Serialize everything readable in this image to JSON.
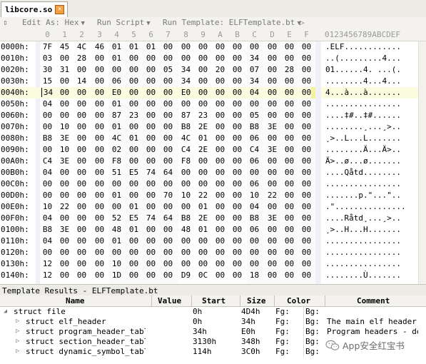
{
  "tab": {
    "title": "libcore.so"
  },
  "toolbar": {
    "edit_as": "Edit As: Hex",
    "run_script": "Run Script",
    "run_template": "Run Template: ELFTemplate.bt"
  },
  "columns": [
    "0",
    "1",
    "2",
    "3",
    "4",
    "5",
    "6",
    "7",
    "8",
    "9",
    "A",
    "B",
    "C",
    "D",
    "E",
    "F"
  ],
  "ascii_header": "0123456789ABCDEF",
  "rows": [
    {
      "addr": "0000h:",
      "bytes": [
        "7F",
        "45",
        "4C",
        "46",
        "01",
        "01",
        "01",
        "00",
        "00",
        "00",
        "00",
        "00",
        "00",
        "00",
        "00",
        "00"
      ],
      "ascii": ".ELF............"
    },
    {
      "addr": "0010h:",
      "bytes": [
        "03",
        "00",
        "28",
        "00",
        "01",
        "00",
        "00",
        "00",
        "00",
        "00",
        "00",
        "00",
        "34",
        "00",
        "00",
        "00"
      ],
      "ascii": "..(.........4..."
    },
    {
      "addr": "0020h:",
      "bytes": [
        "30",
        "31",
        "00",
        "00",
        "00",
        "00",
        "00",
        "05",
        "34",
        "00",
        "20",
        "00",
        "07",
        "00",
        "28",
        "00"
      ],
      "ascii": "01......4. ...(."
    },
    {
      "addr": "0030h:",
      "bytes": [
        "15",
        "00",
        "14",
        "00",
        "06",
        "00",
        "00",
        "00",
        "34",
        "00",
        "00",
        "00",
        "34",
        "00",
        "00",
        "00"
      ],
      "ascii": "........4...4..."
    },
    {
      "addr": "0040h:",
      "bytes": [
        "34",
        "00",
        "00",
        "00",
        "E0",
        "00",
        "00",
        "00",
        "E0",
        "00",
        "00",
        "00",
        "04",
        "00",
        "00",
        "00"
      ],
      "ascii": "4...à...à......."
    },
    {
      "addr": "0050h:",
      "bytes": [
        "04",
        "00",
        "00",
        "00",
        "01",
        "00",
        "00",
        "00",
        "00",
        "00",
        "00",
        "00",
        "00",
        "00",
        "00",
        "00"
      ],
      "ascii": "................"
    },
    {
      "addr": "0060h:",
      "bytes": [
        "00",
        "00",
        "00",
        "00",
        "87",
        "23",
        "00",
        "00",
        "87",
        "23",
        "00",
        "00",
        "05",
        "00",
        "00",
        "00"
      ],
      "ascii": "....‡#..‡#......"
    },
    {
      "addr": "0070h:",
      "bytes": [
        "00",
        "10",
        "00",
        "00",
        "01",
        "00",
        "00",
        "00",
        "B8",
        "2E",
        "00",
        "00",
        "B8",
        "3E",
        "00",
        "00"
      ],
      "ascii": "........¸...¸>.."
    },
    {
      "addr": "0080h:",
      "bytes": [
        "B8",
        "3E",
        "00",
        "00",
        "4C",
        "01",
        "00",
        "00",
        "4C",
        "01",
        "00",
        "00",
        "06",
        "00",
        "00",
        "00"
      ],
      "ascii": "¸>..L...L......."
    },
    {
      "addr": "0090h:",
      "bytes": [
        "00",
        "10",
        "00",
        "00",
        "02",
        "00",
        "00",
        "00",
        "C4",
        "2E",
        "00",
        "00",
        "C4",
        "3E",
        "00",
        "00"
      ],
      "ascii": "........Ä...Ä>.."
    },
    {
      "addr": "00A0h:",
      "bytes": [
        "C4",
        "3E",
        "00",
        "00",
        "F8",
        "00",
        "00",
        "00",
        "F8",
        "00",
        "00",
        "00",
        "06",
        "00",
        "00",
        "00"
      ],
      "ascii": "Ä>..ø...ø......."
    },
    {
      "addr": "00B0h:",
      "bytes": [
        "04",
        "00",
        "00",
        "00",
        "51",
        "E5",
        "74",
        "64",
        "00",
        "00",
        "00",
        "00",
        "00",
        "00",
        "00",
        "00"
      ],
      "ascii": "....Qåtd........"
    },
    {
      "addr": "00C0h:",
      "bytes": [
        "00",
        "00",
        "00",
        "00",
        "00",
        "00",
        "00",
        "00",
        "00",
        "00",
        "00",
        "00",
        "06",
        "00",
        "00",
        "00"
      ],
      "ascii": "................"
    },
    {
      "addr": "00D0h:",
      "bytes": [
        "00",
        "00",
        "00",
        "00",
        "01",
        "00",
        "00",
        "70",
        "10",
        "22",
        "00",
        "00",
        "10",
        "22",
        "00",
        "00"
      ],
      "ascii": ".......p.\"...\".."
    },
    {
      "addr": "00E0h:",
      "bytes": [
        "10",
        "22",
        "00",
        "00",
        "00",
        "01",
        "00",
        "00",
        "00",
        "01",
        "00",
        "00",
        "04",
        "00",
        "00",
        "00"
      ],
      "ascii": ".\"..............."
    },
    {
      "addr": "00F0h:",
      "bytes": [
        "04",
        "00",
        "00",
        "00",
        "52",
        "E5",
        "74",
        "64",
        "B8",
        "2E",
        "00",
        "00",
        "B8",
        "3E",
        "00",
        "00"
      ],
      "ascii": "....Råtd¸...¸>.."
    },
    {
      "addr": "0100h:",
      "bytes": [
        "B8",
        "3E",
        "00",
        "00",
        "48",
        "01",
        "00",
        "00",
        "48",
        "01",
        "00",
        "00",
        "06",
        "00",
        "00",
        "00"
      ],
      "ascii": "¸>..H...H......."
    },
    {
      "addr": "0110h:",
      "bytes": [
        "04",
        "00",
        "00",
        "00",
        "01",
        "00",
        "00",
        "00",
        "00",
        "00",
        "00",
        "00",
        "00",
        "00",
        "00",
        "00"
      ],
      "ascii": "................"
    },
    {
      "addr": "0120h:",
      "bytes": [
        "00",
        "00",
        "00",
        "00",
        "00",
        "00",
        "00",
        "00",
        "00",
        "00",
        "00",
        "00",
        "00",
        "00",
        "00",
        "00"
      ],
      "ascii": "................"
    },
    {
      "addr": "0130h:",
      "bytes": [
        "12",
        "00",
        "00",
        "00",
        "10",
        "00",
        "00",
        "00",
        "00",
        "00",
        "00",
        "00",
        "00",
        "00",
        "00",
        "00"
      ],
      "ascii": "................"
    },
    {
      "addr": "0140h:",
      "bytes": [
        "12",
        "00",
        "00",
        "00",
        "1D",
        "00",
        "00",
        "00",
        "D9",
        "0C",
        "00",
        "00",
        "18",
        "00",
        "00",
        "00"
      ],
      "ascii": "........Ù......."
    }
  ],
  "template_results": {
    "title": "Template Results - ELFTemplate.bt",
    "headers": {
      "name": "Name",
      "value": "Value",
      "start": "Start",
      "size": "Size",
      "color": "Color",
      "comment": "Comment"
    },
    "rows": [
      {
        "name": "struct file",
        "value": "",
        "start": "0h",
        "size": "4D4h",
        "fg": "Fg:",
        "bg": "Bg:",
        "comment": "",
        "level": 0,
        "expanded": true
      },
      {
        "name": "struct elf_header",
        "value": "",
        "start": "0h",
        "size": "34h",
        "fg": "Fg:",
        "bg": "Bg:",
        "comment": "The main elf header",
        "level": 1,
        "expanded": false
      },
      {
        "name": "struct program_header_table",
        "value": "",
        "start": "34h",
        "size": "E0h",
        "fg": "Fg:",
        "bg": "Bg:",
        "comment": "Program headers - de",
        "level": 1,
        "expanded": false
      },
      {
        "name": "struct section_header_table",
        "value": "",
        "start": "3130h",
        "size": "348h",
        "fg": "Fg:",
        "bg": "Bg:",
        "comment": "",
        "level": 1,
        "expanded": false
      },
      {
        "name": "struct dynamic_symbol_table",
        "value": "",
        "start": "114h",
        "size": "3C0h",
        "fg": "Fg:",
        "bg": "Bg:",
        "comment": "",
        "level": 1,
        "expanded": false
      }
    ]
  },
  "watermark": {
    "text": "App安全红宝书"
  },
  "colors": {
    "highlight": "#f5f29e",
    "row_band": "#ececf8",
    "scroll_band": "#f0f0f8"
  },
  "cursor": {
    "row": 4,
    "col": 0
  }
}
